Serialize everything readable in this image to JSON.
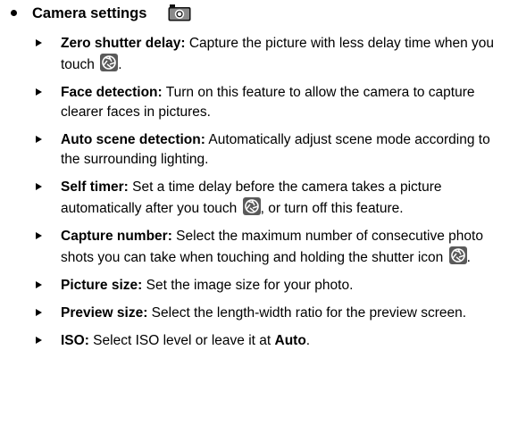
{
  "section": {
    "title": "Camera settings",
    "title_icon": "camera-icon"
  },
  "items": [
    {
      "label": "Zero shutter delay:",
      "text_before": " Capture the picture with less delay time when you touch ",
      "icon": "shutter-icon",
      "text_after": "."
    },
    {
      "label": "Face detection:",
      "text_before": " Turn on this feature to allow the camera to capture clearer faces in pictures."
    },
    {
      "label": "Auto scene detection:",
      "text_before": " Automatically adjust scene mode according to the surrounding lighting."
    },
    {
      "label": "Self timer:",
      "text_before": " Set a time delay before the camera takes a picture automatically after you touch ",
      "icon": "shutter-icon",
      "text_after": ", or turn off this feature."
    },
    {
      "label": "Capture number:",
      "text_before": " Select the maximum number of consecutive photo shots you can take when touching and holding the shutter icon ",
      "icon": "shutter-icon",
      "text_after": "."
    },
    {
      "label": "Picture size:",
      "text_before": " Set the image size for your photo."
    },
    {
      "label": "Preview size:",
      "text_before": " Select the length-width ratio for the preview screen."
    },
    {
      "label": "ISO:",
      "text_before": " Select ISO level or leave it at ",
      "bold_tail": "Auto",
      "text_after": "."
    }
  ]
}
